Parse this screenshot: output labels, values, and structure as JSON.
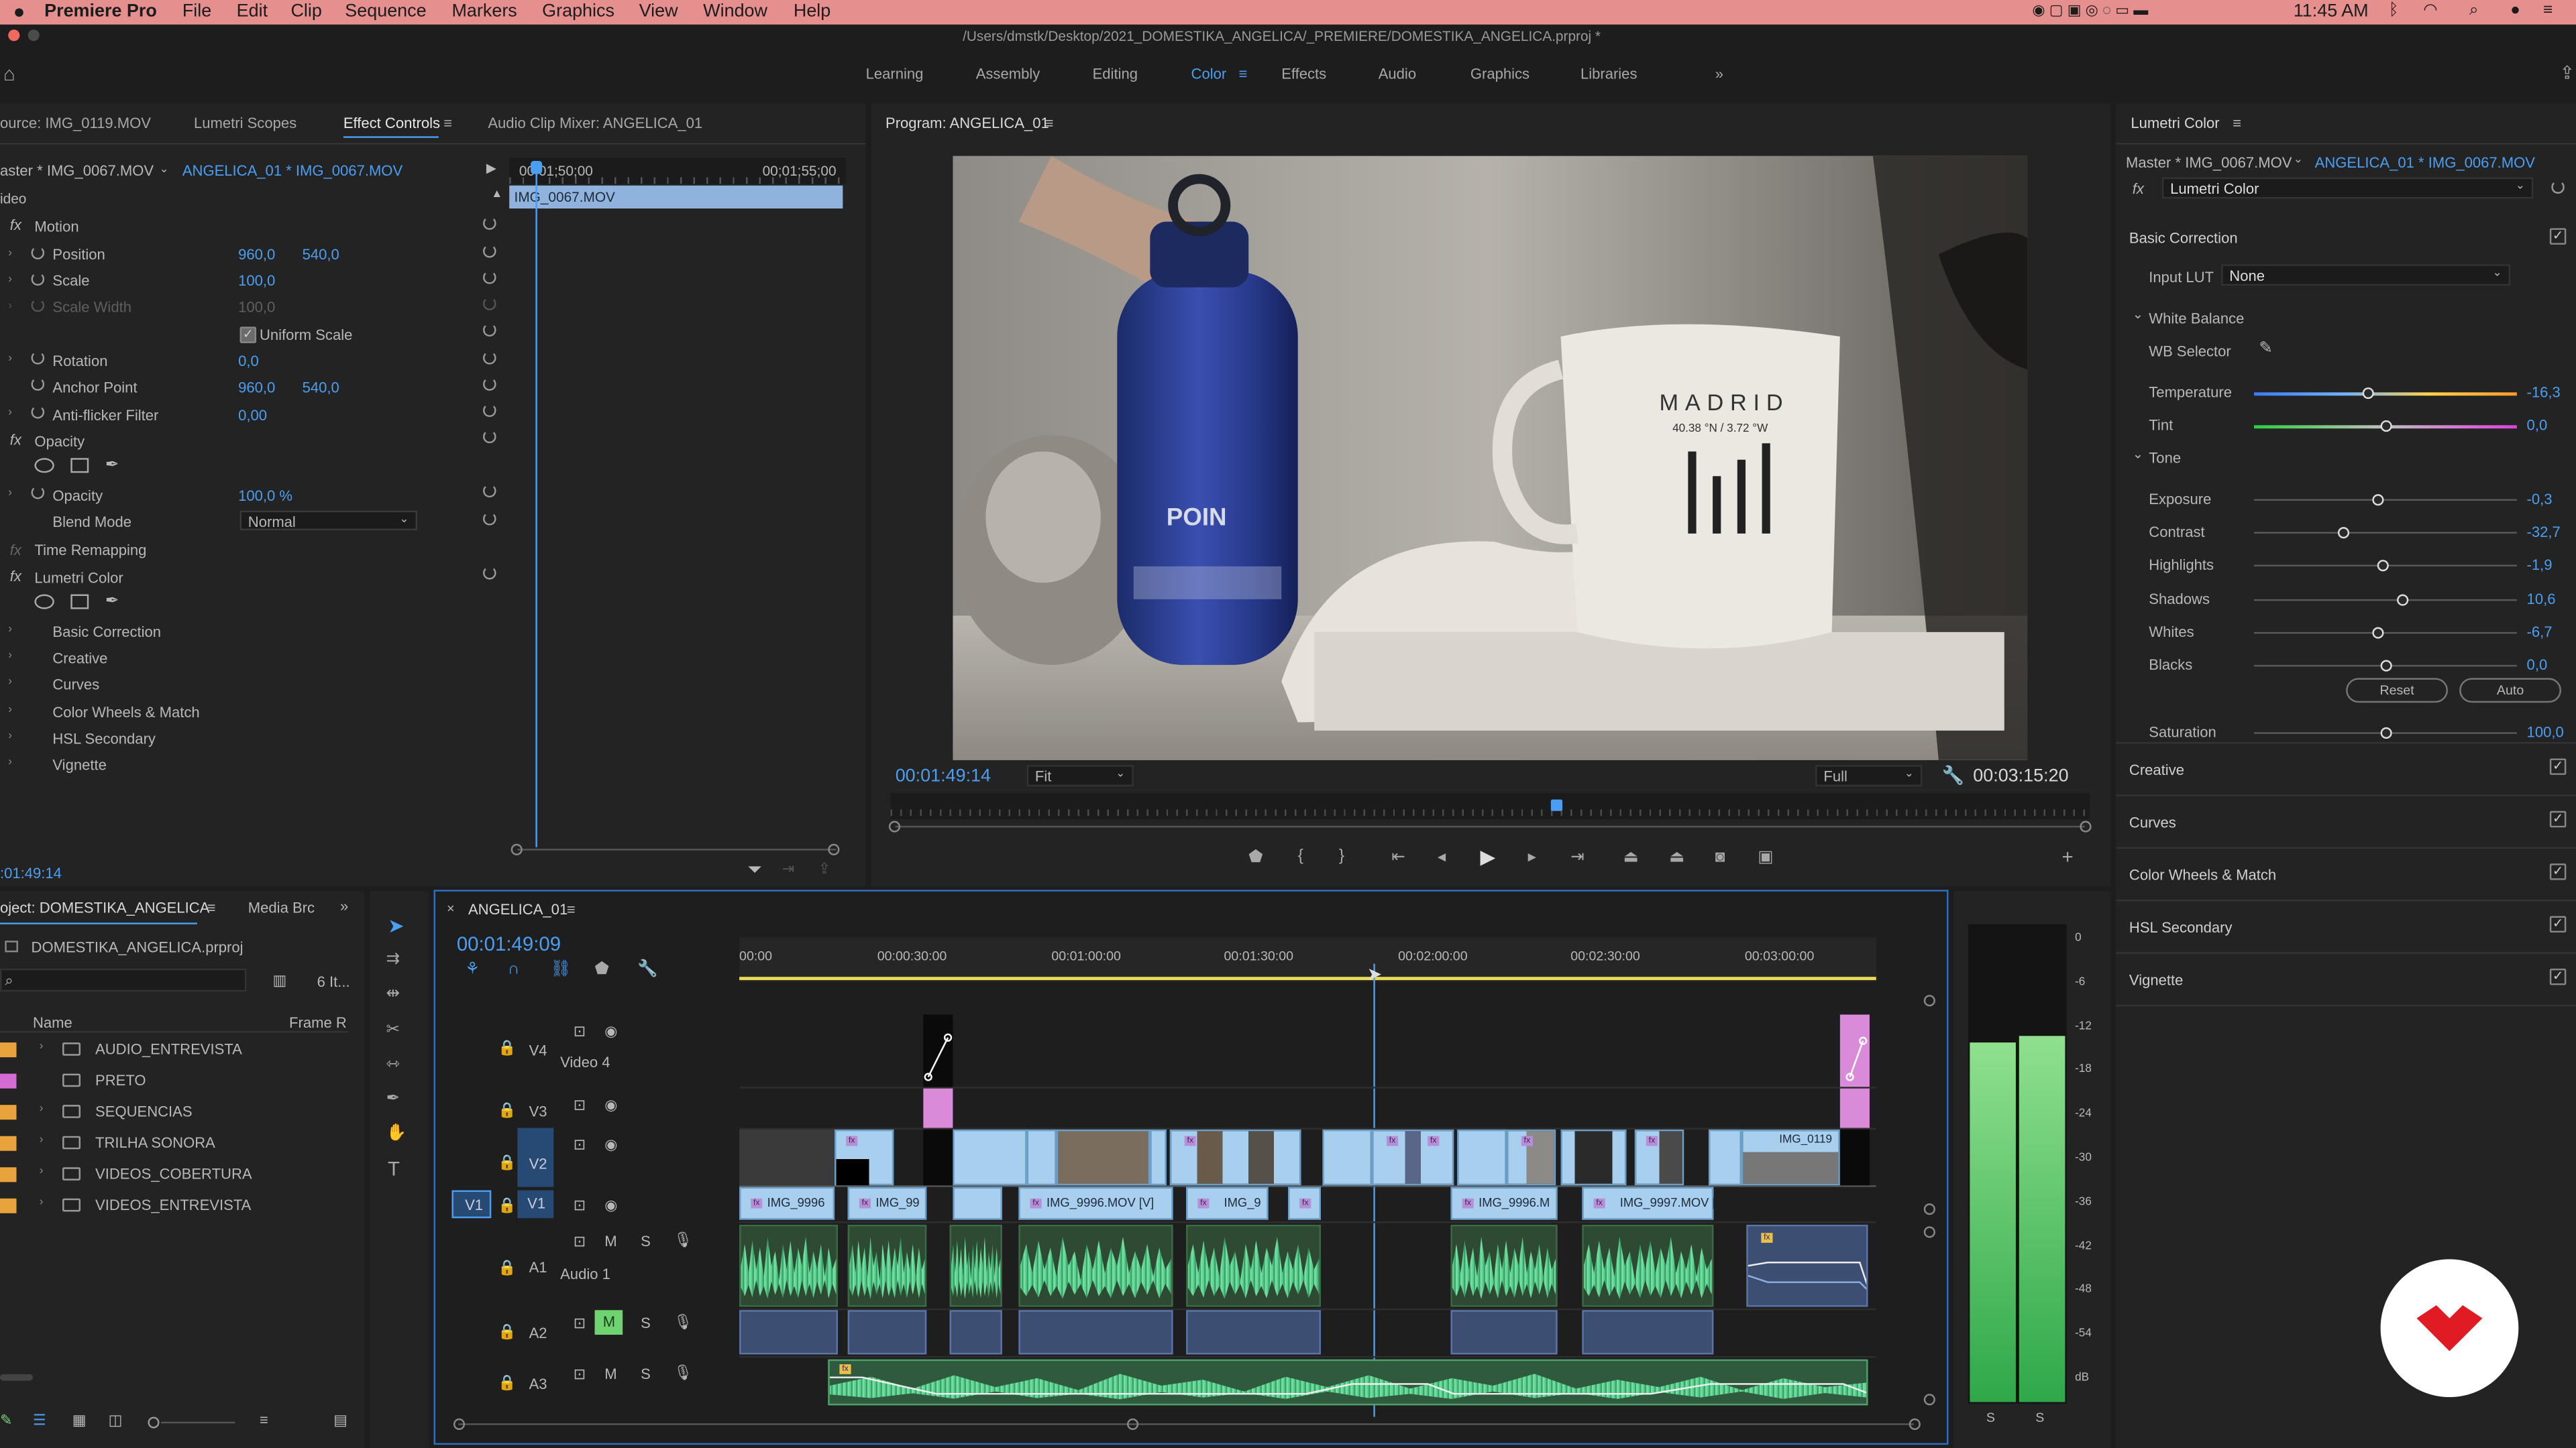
{
  "menubar": {
    "app": "Premiere Pro",
    "items": [
      "File",
      "Edit",
      "Clip",
      "Sequence",
      "Markers",
      "Graphics",
      "View",
      "Window",
      "Help"
    ],
    "time": "11:45 AM"
  },
  "title": "/Users/dmstk/Desktop/2021_DOMESTIKA_ANGELICA/_PREMIERE/DOMESTIKA_ANGELICA.prproj *",
  "workspaces": {
    "tabs": [
      "Learning",
      "Assembly",
      "Editing",
      "Color",
      "Effects",
      "Audio",
      "Graphics",
      "Libraries"
    ],
    "active": "Color"
  },
  "effect_controls": {
    "tabs": [
      "ource: IMG_0119.MOV",
      "Lumetri Scopes",
      "Effect Controls",
      "Audio Clip Mixer: ANGELICA_01"
    ],
    "master": "aster * IMG_0067.MOV",
    "sequence_clip": "ANGELICA_01 * IMG_0067.MOV",
    "section_video": "ideo",
    "ruler_start": "00;01;50;00",
    "ruler_end": "00;01;55;00",
    "clip_name": "IMG_0067.MOV",
    "motion": "Motion",
    "position_label": "Position",
    "position_x": "960,0",
    "position_y": "540,0",
    "scale_label": "Scale",
    "scale_value": "100,0",
    "scale_width_label": "Scale Width",
    "scale_width_value": "100,0",
    "uniform_scale": "Uniform Scale",
    "rotation_label": "Rotation",
    "rotation_value": "0,0",
    "anchor_label": "Anchor Point",
    "anchor_x": "960,0",
    "anchor_y": "540,0",
    "antiflicker_label": "Anti-flicker Filter",
    "antiflicker_value": "0,00",
    "opacity_section": "Opacity",
    "opacity_label": "Opacity",
    "opacity_value": "100,0 %",
    "blend_label": "Blend Mode",
    "blend_value": "Normal",
    "time_remapping": "Time Remapping",
    "lumetri": "Lumetri Color",
    "lumetri_items": [
      "Basic Correction",
      "Creative",
      "Curves",
      "Color Wheels & Match",
      "HSL Secondary",
      "Vignette"
    ],
    "timecode": ":01:49:14"
  },
  "program": {
    "title": "Program: ANGELICA_01",
    "timecode": "00:01:49:14",
    "fit": "Fit",
    "quality": "Full",
    "duration": "00:03:15:20",
    "playhead_fraction": 0.55,
    "frame_text": {
      "mug_line1": "MADRID",
      "mug_line2": "40.38 °N / 3.72 °W",
      "bottle": "POIN"
    }
  },
  "lumetri_color": {
    "title": "Lumetri Color",
    "master": "Master * IMG_0067.MOV",
    "clip": "ANGELICA_01 * IMG_0067.MOV",
    "effect": "Lumetri Color",
    "basic_correction": "Basic Correction",
    "input_lut_label": "Input LUT",
    "input_lut_value": "None",
    "white_balance": "White Balance",
    "wb_selector": "WB Selector",
    "tone": "Tone",
    "reset": "Reset",
    "auto": "Auto",
    "sliders": [
      {
        "label": "Temperature",
        "value": "-16,3",
        "pos": 0.43,
        "track": "temperature"
      },
      {
        "label": "Tint",
        "value": "0,0",
        "pos": 0.5,
        "track": "tint"
      },
      {
        "label": "Exposure",
        "value": "-0,3",
        "pos": 0.47,
        "track": "plain"
      },
      {
        "label": "Contrast",
        "value": "-32,7",
        "pos": 0.34,
        "track": "plain"
      },
      {
        "label": "Highlights",
        "value": "-1,9",
        "pos": 0.49,
        "track": "plain"
      },
      {
        "label": "Shadows",
        "value": "10,6",
        "pos": 0.56,
        "track": "plain"
      },
      {
        "label": "Whites",
        "value": "-6,7",
        "pos": 0.47,
        "track": "plain"
      },
      {
        "label": "Blacks",
        "value": "0,0",
        "pos": 0.5,
        "track": "plain"
      },
      {
        "label": "Saturation",
        "value": "100,0",
        "pos": 0.5,
        "track": "plain"
      }
    ],
    "sections": [
      "Creative",
      "Curves",
      "Color Wheels & Match",
      "HSL Secondary",
      "Vignette"
    ]
  },
  "project": {
    "title": "oject: DOMESTIKA_ANGELICA",
    "media_browser": "Media Brc",
    "file": "DOMESTIKA_ANGELICA.prproj",
    "count": "6 It...",
    "col_name": "Name",
    "col_framerate": "Frame R",
    "items": [
      {
        "name": "AUDIO_ENTREVISTA",
        "color": "#e8a33c",
        "type": "folder"
      },
      {
        "name": "PRETO",
        "color": "#d46ad4",
        "type": "clip"
      },
      {
        "name": "SEQUENCIAS",
        "color": "#e8a33c",
        "type": "folder"
      },
      {
        "name": "TRILHA SONORA",
        "color": "#e8a33c",
        "type": "folder"
      },
      {
        "name": "VIDEOS_COBERTURA",
        "color": "#e8a33c",
        "type": "folder"
      },
      {
        "name": "VIDEOS_ENTREVISTA",
        "color": "#e8a33c",
        "type": "folder"
      }
    ]
  },
  "timeline": {
    "title": "ANGELICA_01",
    "timecode": "00:01:49:09",
    "ruler": [
      "00:00",
      "00:00:30:00",
      "00:01:00:00",
      "00:01:30:00",
      "00:02:00:00",
      "00:02:30:00",
      "00:03:00:00"
    ],
    "tracks": {
      "V4": "V4",
      "video4": "Video 4",
      "V3": "V3",
      "V2": "V2",
      "V1": "V1",
      "A1": "A1",
      "audio1": "Audio 1",
      "A2": "A2",
      "A3": "A3"
    },
    "track_buttons": {
      "mute": "M",
      "solo": "S"
    },
    "v1_clips": [
      "IMG_9996",
      "IMG_99",
      "IMG_9996.MOV [V]",
      "IMG_9",
      "IMG_9996.M",
      "IMG_9997.MOV ["
    ],
    "v2_clip": "IMG_0119"
  },
  "meters": {
    "scale": [
      "0",
      "-6",
      "-12",
      "-18",
      "-24",
      "-30",
      "-36",
      "-42",
      "-48",
      "-54",
      "dB"
    ],
    "solo": "S",
    "level_left_db": -15,
    "level_right_db": -14
  }
}
